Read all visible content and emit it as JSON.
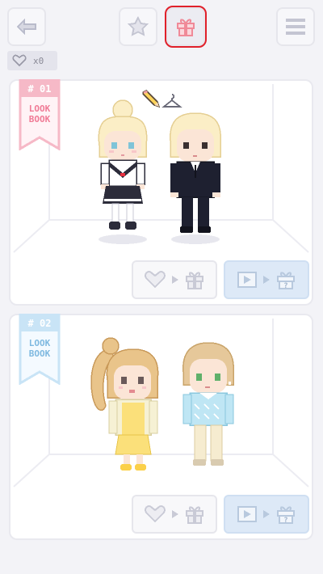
{
  "toolbar": {
    "back": "back-arrow-icon",
    "favorite": "star-icon",
    "gift": "gift-icon",
    "menu": "menu-icon",
    "accent": "#e0202a"
  },
  "like_counter": {
    "icon": "heart-icon",
    "value": "x0"
  },
  "lookbooks": [
    {
      "number": "# 01",
      "word_line1": "LOOK",
      "word_line2": "BOOK",
      "ribbon_color": "#f6b9c7",
      "ribbon_text_color": "#f07b96",
      "edit_icons": [
        "pencil-icon",
        "hanger-icon"
      ],
      "characters": [
        "girl-in-sailor-uniform",
        "boy-in-black-suit"
      ],
      "like_action": [
        "heart-icon",
        "arrow-right-icon",
        "gift-icon"
      ],
      "video_action": [
        "video-icon",
        "arrow-right-icon",
        "mystery-gift-icon"
      ]
    },
    {
      "number": "# 02",
      "word_line1": "LOOK",
      "word_line2": "BOOK",
      "ribbon_color": "#c9e4f6",
      "ribbon_text_color": "#7fb9e0",
      "edit_icons": [],
      "characters": [
        "girl-in-yellow-dress",
        "boy-in-blue-sweater"
      ],
      "like_action": [
        "heart-icon",
        "arrow-right-icon",
        "gift-icon"
      ],
      "video_action": [
        "video-icon",
        "arrow-right-icon",
        "mystery-gift-icon"
      ]
    }
  ]
}
